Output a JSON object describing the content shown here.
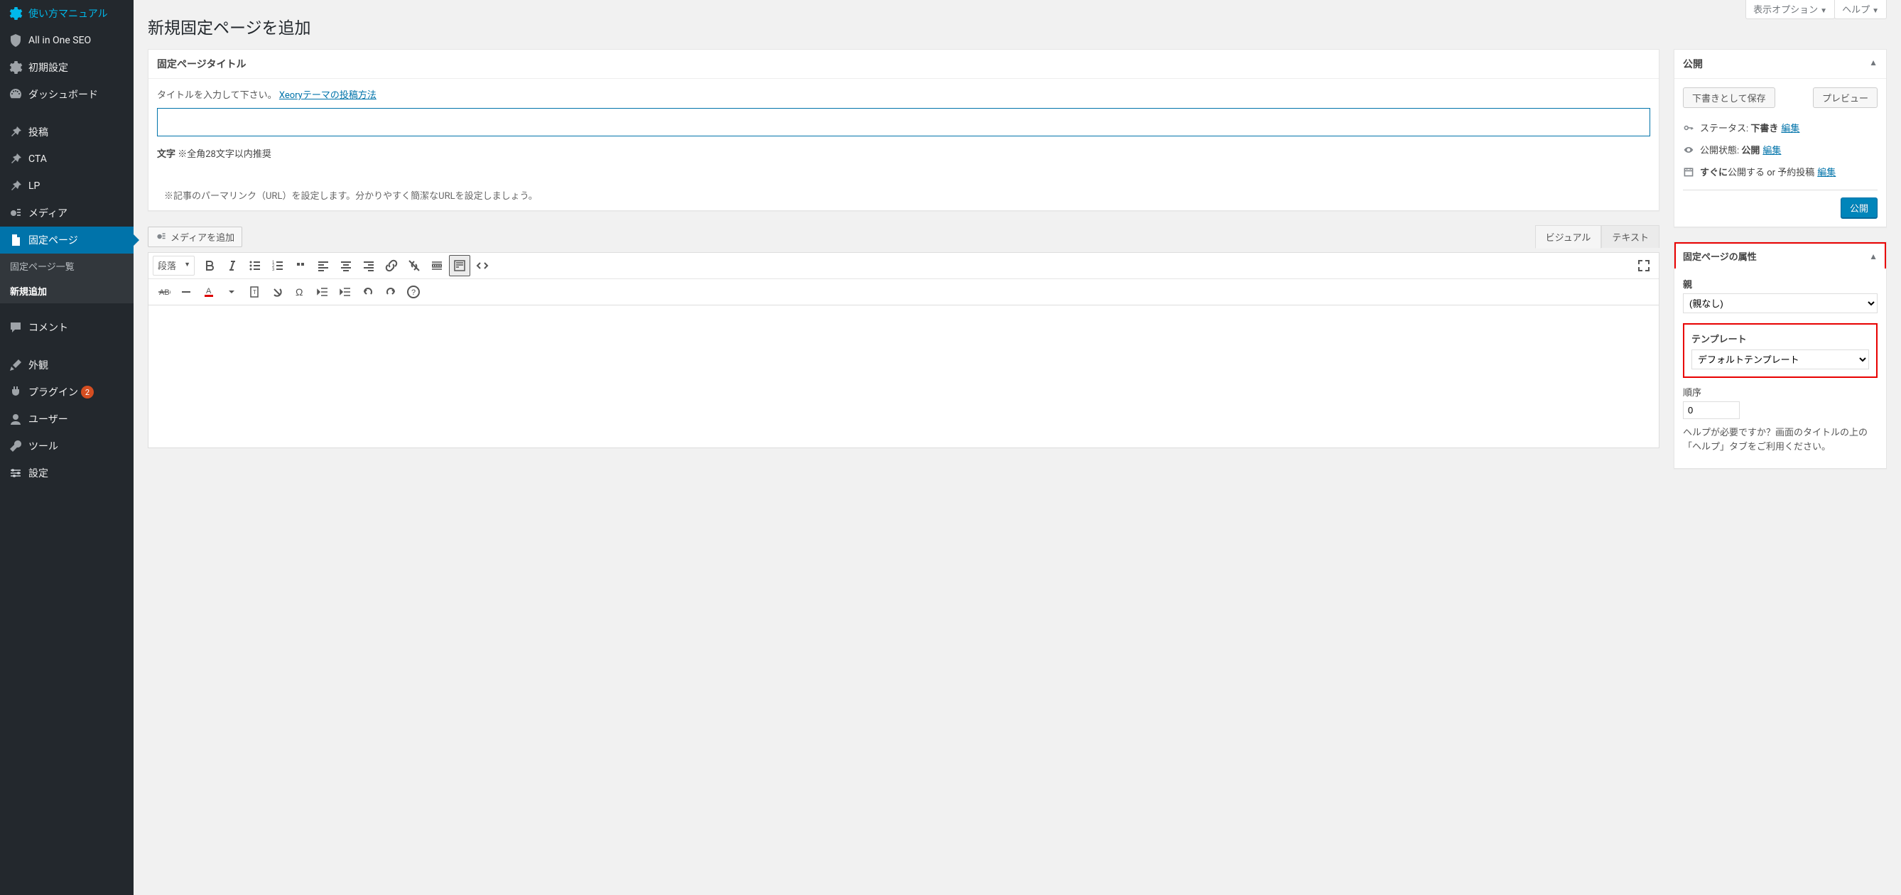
{
  "sidebar": {
    "items": [
      {
        "label": "使い方マニュアル",
        "icon": "gear"
      },
      {
        "label": "All in One SEO",
        "icon": "shield"
      },
      {
        "label": "初期設定",
        "icon": "gear"
      },
      {
        "label": "ダッシュボード",
        "icon": "dashboard"
      },
      {
        "label": "投稿",
        "icon": "pin"
      },
      {
        "label": "CTA",
        "icon": "pin"
      },
      {
        "label": "LP",
        "icon": "pin"
      },
      {
        "label": "メディア",
        "icon": "media"
      },
      {
        "label": "固定ページ",
        "icon": "page"
      },
      {
        "label": "コメント",
        "icon": "comment"
      },
      {
        "label": "外観",
        "icon": "brush"
      },
      {
        "label": "プラグイン",
        "icon": "plugin",
        "badge": "2"
      },
      {
        "label": "ユーザー",
        "icon": "user"
      },
      {
        "label": "ツール",
        "icon": "wrench"
      },
      {
        "label": "設定",
        "icon": "sliders"
      }
    ],
    "submenu": [
      {
        "label": "固定ページ一覧"
      },
      {
        "label": "新規追加"
      }
    ]
  },
  "screen_meta": {
    "options": "表示オプション",
    "help": "ヘルプ"
  },
  "page_title": "新規固定ページを追加",
  "title_box": {
    "heading": "固定ページタイトル",
    "instruction": "タイトルを入力して下さい。",
    "link_text": "Xeoryテーマの投稿方法",
    "input_value": "",
    "char_label": "文字",
    "char_note": "※全角28文字以内推奨",
    "permalink_note": "※記事のパーマリンク（URL）を設定します。分かりやすく簡潔なURLを設定しましょう。"
  },
  "editor": {
    "media_button": "メディアを追加",
    "tabs": {
      "visual": "ビジュアル",
      "text": "テキスト"
    },
    "format_select": "段落"
  },
  "publish_box": {
    "heading": "公開",
    "save_draft": "下書きとして保存",
    "preview": "プレビュー",
    "status_label": "ステータス:",
    "status_value": "下書き",
    "visibility_label": "公開状態:",
    "visibility_value": "公開",
    "schedule_bold": "すぐに",
    "schedule_rest": "公開する or 予約投稿",
    "edit": "編集",
    "submit": "公開"
  },
  "attributes_box": {
    "heading": "固定ページの属性",
    "parent_label": "親",
    "parent_value": "(親なし)",
    "template_label": "テンプレート",
    "template_value": "デフォルトテンプレート",
    "order_label": "順序",
    "order_value": "0",
    "help_text": "ヘルプが必要ですか？画面のタイトルの上の「ヘルプ」タブをご利用ください。"
  }
}
